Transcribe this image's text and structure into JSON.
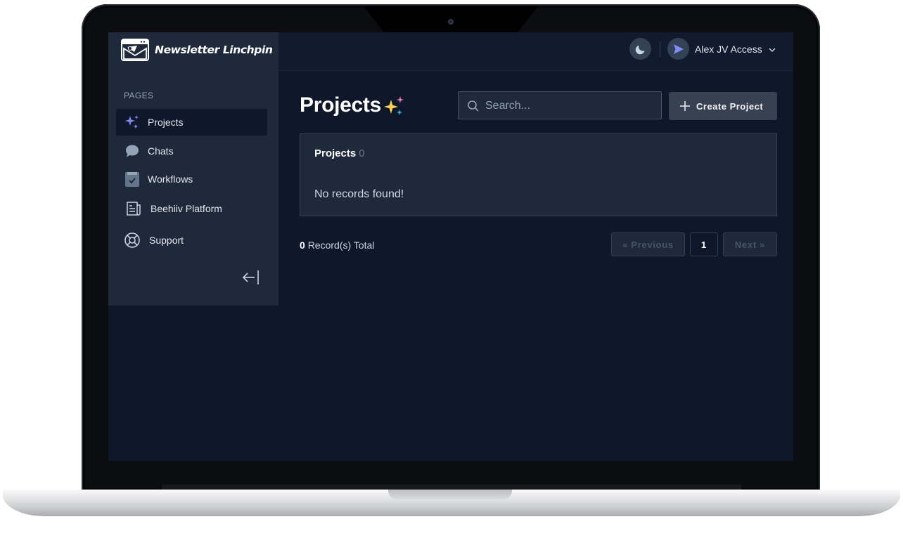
{
  "app": {
    "brand_name": "Newsletter Linchpin"
  },
  "topbar": {
    "user_name": "Alex JV Access"
  },
  "sidebar": {
    "section_label": "PAGES",
    "items": [
      {
        "label": "Projects",
        "icon": "sparkles-icon",
        "active": true
      },
      {
        "label": "Chats",
        "icon": "chat-bubble-icon",
        "active": false
      },
      {
        "label": "Workflows",
        "icon": "clipboard-check-icon",
        "active": false
      },
      {
        "label": "Beehiiv Platform",
        "icon": "newspaper-icon",
        "active": false
      },
      {
        "label": "Support",
        "icon": "lifebuoy-icon",
        "active": false
      }
    ]
  },
  "main": {
    "title": "Projects",
    "title_emoji": "✨",
    "search": {
      "placeholder": "Search..."
    },
    "create_label": "Create Project",
    "card": {
      "title": "Projects",
      "count": "0",
      "empty_message": "No records found!"
    },
    "total": {
      "count": "0",
      "label": "Record(s) Total"
    },
    "pagination": {
      "prev_label": "« Previous",
      "current_page": "1",
      "next_label": "Next »"
    }
  },
  "colors": {
    "background": "#0f172a",
    "sidebar": "#1e293b",
    "accent_sparkle": "#818cf8",
    "button": "#374151"
  }
}
